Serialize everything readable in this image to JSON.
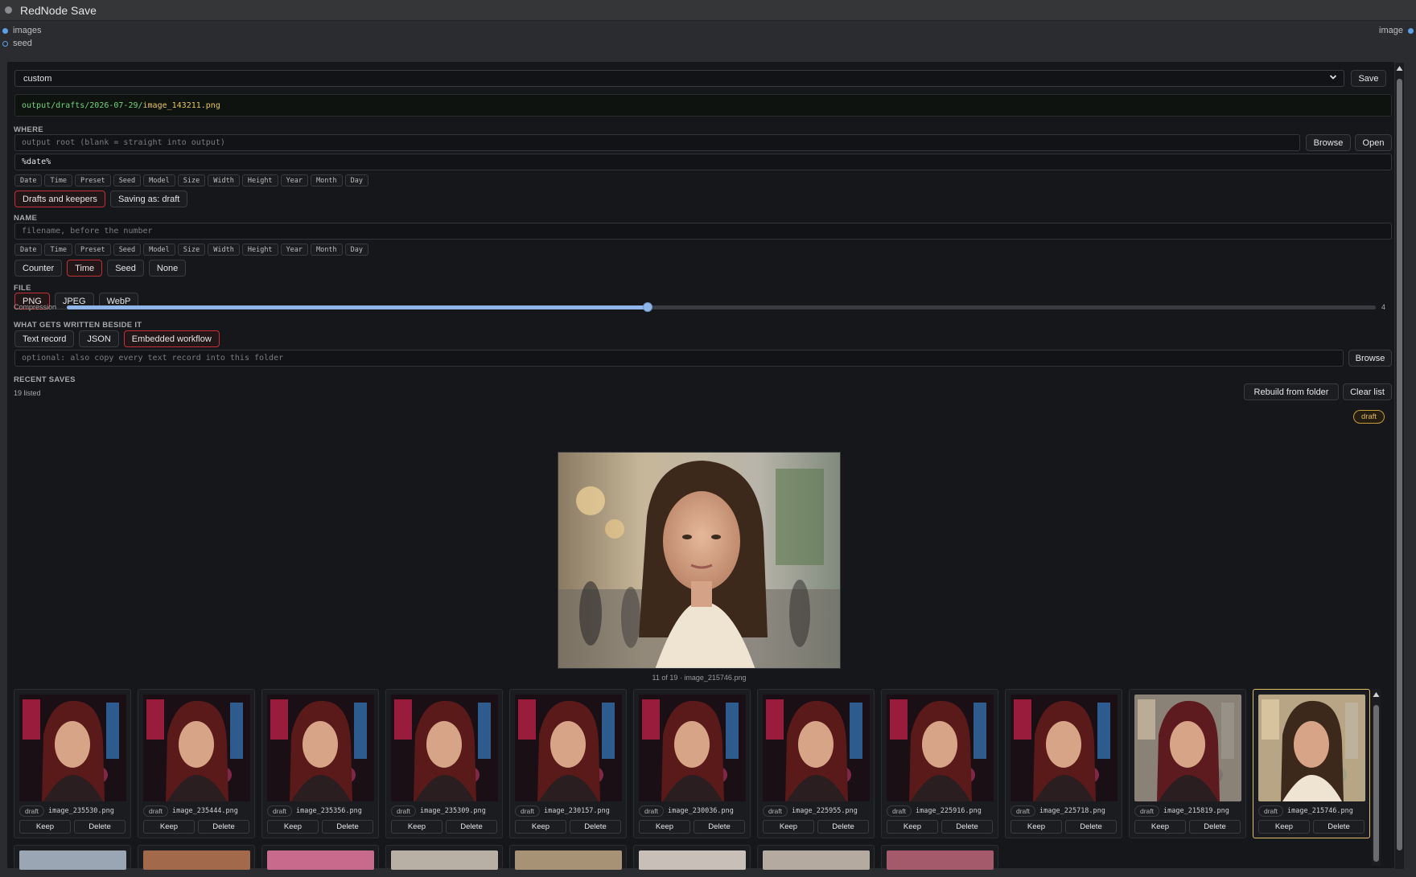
{
  "node": {
    "title": "RedNode Save"
  },
  "slots": {
    "inputs": [
      "images",
      "seed"
    ],
    "output": "image"
  },
  "preset": {
    "value": "custom",
    "save_label": "Save"
  },
  "path": {
    "dir": "output/drafts/2026-07-29/",
    "file": "image_143211.png"
  },
  "where": {
    "label": "WHERE",
    "root_placeholder": "output root (blank = straight into output)",
    "browse_label": "Browse",
    "open_label": "Open",
    "folder_value": "%date%",
    "tokens": [
      "Date",
      "Time",
      "Preset",
      "Seed",
      "Model",
      "Size",
      "Width",
      "Height",
      "Year",
      "Month",
      "Day"
    ],
    "modes": [
      {
        "label": "Drafts and keepers",
        "active": true
      },
      {
        "label": "Saving as: draft",
        "active": false
      }
    ]
  },
  "name": {
    "label": "NAME",
    "placeholder": "filename, before the number",
    "tokens": [
      "Date",
      "Time",
      "Preset",
      "Seed",
      "Model",
      "Size",
      "Width",
      "Height",
      "Year",
      "Month",
      "Day"
    ],
    "suffix_options": [
      {
        "label": "Counter",
        "active": false
      },
      {
        "label": "Time",
        "active": true
      },
      {
        "label": "Seed",
        "active": false
      },
      {
        "label": "None",
        "active": false
      }
    ]
  },
  "file": {
    "label": "FILE",
    "formats": [
      {
        "label": "PNG",
        "active": true
      },
      {
        "label": "JPEG",
        "active": false
      },
      {
        "label": "WebP",
        "active": false
      }
    ],
    "compression_label": "Compression",
    "compression_value": "4",
    "compression_fraction": 0.444
  },
  "sidecar": {
    "label": "WHAT GETS WRITTEN BESIDE IT",
    "options": [
      {
        "label": "Text record",
        "active": false
      },
      {
        "label": "JSON",
        "active": false
      },
      {
        "label": "Embedded workflow",
        "active": true
      }
    ],
    "folder_placeholder": "optional: also copy every text record into this folder",
    "browse_label": "Browse"
  },
  "recent": {
    "label": "RECENT SAVES",
    "count_text": "19 listed",
    "rebuild_label": "Rebuild from folder",
    "clear_label": "Clear list",
    "preview_tag": "draft",
    "preview_caption": "11 of 19 · image_215746.png",
    "items": [
      {
        "tag": "draft",
        "name": "image_235530.png",
        "keep": "Keep",
        "delete": "Delete",
        "style": "neon",
        "selected": false
      },
      {
        "tag": "draft",
        "name": "image_235444.png",
        "keep": "Keep",
        "delete": "Delete",
        "style": "neon",
        "selected": false
      },
      {
        "tag": "draft",
        "name": "image_235356.png",
        "keep": "Keep",
        "delete": "Delete",
        "style": "neon",
        "selected": false
      },
      {
        "tag": "draft",
        "name": "image_235309.png",
        "keep": "Keep",
        "delete": "Delete",
        "style": "neon",
        "selected": false
      },
      {
        "tag": "draft",
        "name": "image_230157.png",
        "keep": "Keep",
        "delete": "Delete",
        "style": "neon",
        "selected": false
      },
      {
        "tag": "draft",
        "name": "image_230036.png",
        "keep": "Keep",
        "delete": "Delete",
        "style": "neon",
        "selected": false
      },
      {
        "tag": "draft",
        "name": "image_225955.png",
        "keep": "Keep",
        "delete": "Delete",
        "style": "neon",
        "selected": false
      },
      {
        "tag": "draft",
        "name": "image_225916.png",
        "keep": "Keep",
        "delete": "Delete",
        "style": "neon",
        "selected": false
      },
      {
        "tag": "draft",
        "name": "image_225718.png",
        "keep": "Keep",
        "delete": "Delete",
        "style": "neon",
        "selected": false
      },
      {
        "tag": "draft",
        "name": "image_215819.png",
        "keep": "Keep",
        "delete": "Delete",
        "style": "street",
        "selected": false
      },
      {
        "tag": "draft",
        "name": "image_215746.png",
        "keep": "Keep",
        "delete": "Delete",
        "style": "day",
        "selected": true
      }
    ]
  }
}
